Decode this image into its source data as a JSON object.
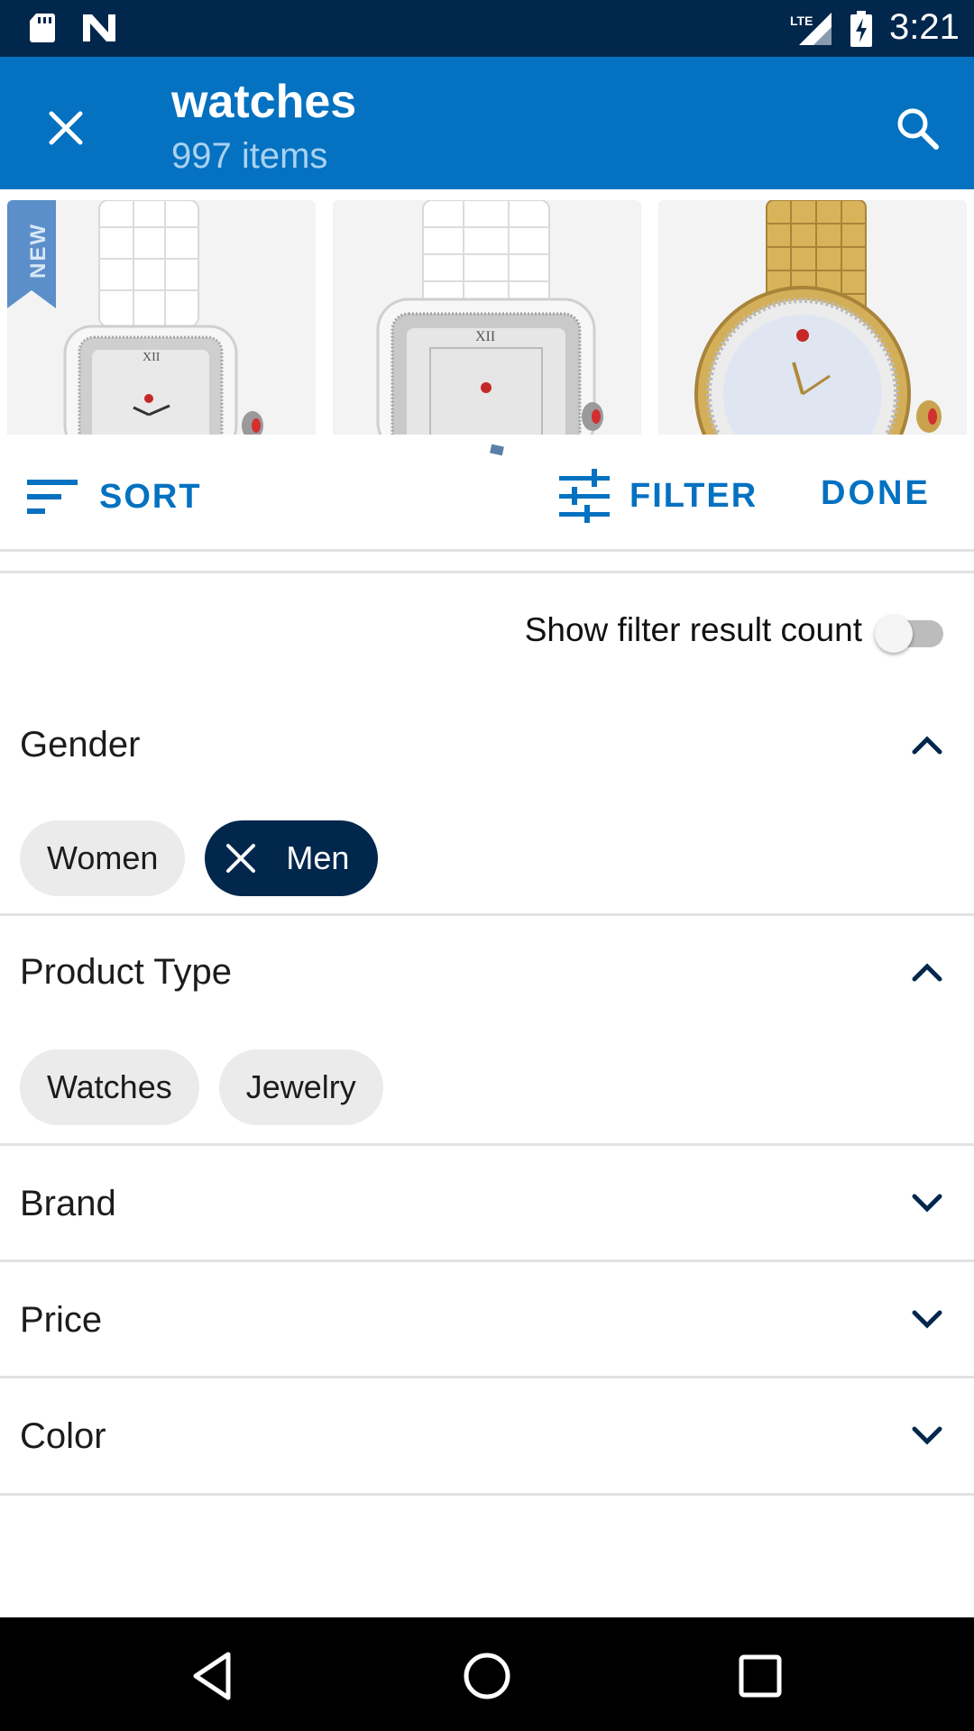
{
  "status_bar": {
    "time": "3:21",
    "network": "LTE",
    "icons": [
      "sd-card-icon",
      "n-notification-icon",
      "lte-signal-icon",
      "battery-charging-icon"
    ]
  },
  "app_bar": {
    "title": "watches",
    "subtitle": "997 items",
    "close_icon": "close-icon",
    "search_icon": "search-icon"
  },
  "products": [
    {
      "badge": "NEW",
      "name": "white ceramic square watch"
    },
    {
      "name": "white ceramic square watch"
    },
    {
      "name": "gold round watch"
    }
  ],
  "action_bar": {
    "sort_label": "SORT",
    "filter_label": "FILTER",
    "done_label": "DONE"
  },
  "toggle": {
    "label": "Show filter result count",
    "on": false
  },
  "sections": {
    "gender": {
      "title": "Gender",
      "expanded": true,
      "chips": [
        {
          "label": "Women",
          "selected": false
        },
        {
          "label": "Men",
          "selected": true
        }
      ]
    },
    "product_type": {
      "title": "Product Type",
      "expanded": true,
      "chips": [
        {
          "label": "Watches",
          "selected": false
        },
        {
          "label": "Jewelry",
          "selected": false
        }
      ]
    },
    "brand": {
      "title": "Brand",
      "expanded": false
    },
    "price": {
      "title": "Price",
      "expanded": false
    },
    "color": {
      "title": "Color",
      "expanded": false
    }
  },
  "colors": {
    "status_bar": "#01274d",
    "app_bar": "#0471c1",
    "accent": "#0471c1",
    "selected_chip": "#01274d",
    "chip": "#ebebeb"
  },
  "nav_bar": {
    "icons": [
      "back-icon",
      "home-icon",
      "recents-icon"
    ]
  }
}
